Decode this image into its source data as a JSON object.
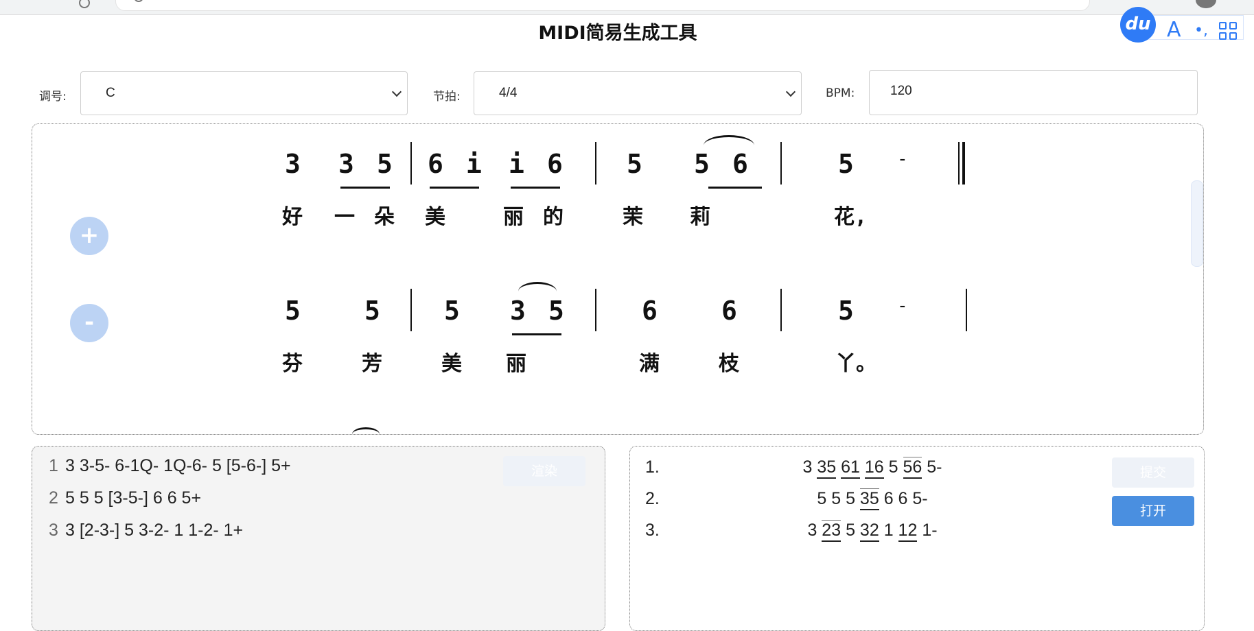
{
  "app": {
    "title": "MIDI简易生成工具"
  },
  "form": {
    "key_label": "调号:",
    "key_value": "C",
    "meter_label": "节拍:",
    "meter_value": "4/4",
    "bpm_label": "BPM:",
    "bpm_value": "120"
  },
  "toolbar": {
    "logo_text": "du",
    "translate_glyph": "A",
    "dot_glyph": "•,"
  },
  "score": {
    "add_label": "+",
    "remove_label": "-",
    "line1": {
      "notes": [
        "3",
        "3",
        "5",
        "|",
        "6",
        "i",
        "i",
        "6",
        "|",
        "5",
        "5",
        "6",
        "|",
        "5",
        "-",
        ":|"
      ],
      "lyrics": [
        "好",
        "一",
        "朵",
        "美",
        "丽",
        "的",
        "茉",
        "莉",
        "花,"
      ]
    },
    "line2": {
      "notes": [
        "5",
        "5",
        "|",
        "5",
        "3",
        "5",
        "|",
        "6",
        "6",
        "|",
        "5",
        "-",
        "|"
      ],
      "lyrics": [
        "芬",
        "芳",
        "美",
        "丽",
        "满",
        "枝",
        "丫。"
      ]
    }
  },
  "editor": {
    "render_label": "渲染",
    "lines": [
      {
        "no": "1",
        "text": "3 3-5- 6-1Q- 1Q-6- 5 [5-6-] 5+"
      },
      {
        "no": "2",
        "text": "5 5 5 [3-5-] 6 6 5+"
      },
      {
        "no": "3",
        "text": "3 [2-3-] 5 3-2- 1 1-2- 1+"
      }
    ]
  },
  "preview": {
    "submit_label": "提交",
    "open_label": "打开",
    "lines": [
      {
        "idx": "1.",
        "tokens": [
          "3",
          "35",
          "61",
          "16",
          "5",
          "56",
          "5-"
        ]
      },
      {
        "idx": "2.",
        "tokens": [
          "5",
          "5",
          "5",
          "35",
          "6",
          "6",
          "5-"
        ]
      },
      {
        "idx": "3.",
        "tokens": [
          "3",
          "23",
          "5",
          "32",
          "1",
          "12",
          "1-"
        ]
      }
    ]
  },
  "colors": {
    "accent": "#4a8fe0",
    "ghost": "#bcd3f4",
    "baidu": "#2f7bf6"
  }
}
